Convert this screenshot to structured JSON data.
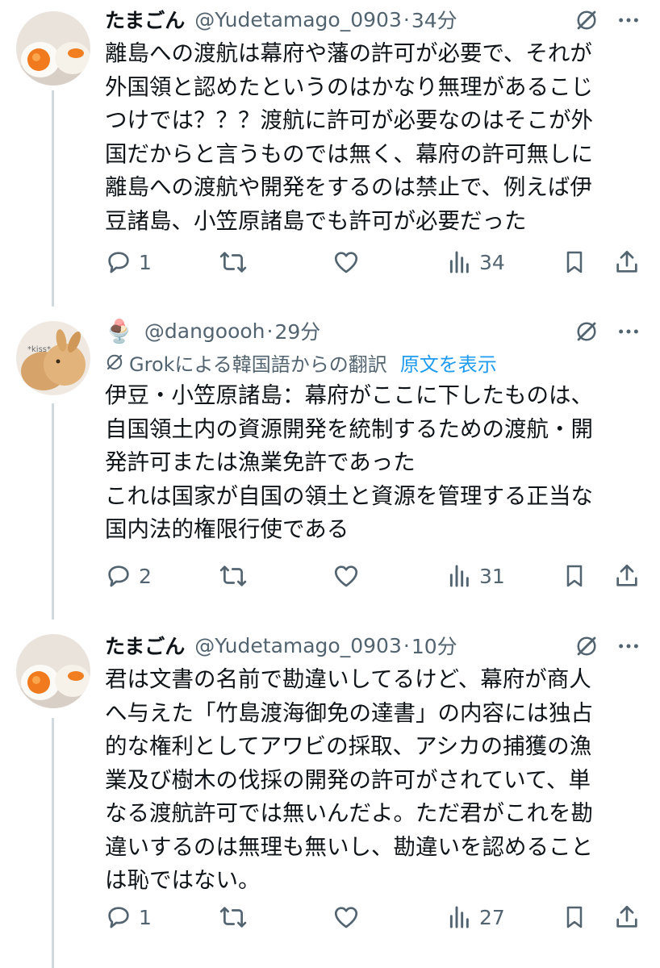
{
  "tweets": [
    {
      "name": "たまごん",
      "handle": "@Yudetamago_0903",
      "dot": "·",
      "time": "34分",
      "text": "離島への渡航は幕府や藩の許可が必要で、それが\n外国領と認めたというのはかなり無理があるこじ\nつけでは？？？渡航に許可が必要なのはそこが外\n国だからと言うものでは無く、幕府の許可無しに\n離島への渡航や開発をするのは禁止で、例えば伊\n豆諸島、小笠原諸島でも許可が必要だった",
      "replies": "1",
      "views": "34"
    },
    {
      "name": "🍨",
      "handle": "@dangoooh",
      "dot": "·",
      "time": "29分",
      "avatar_text": "*kiss*",
      "translate_label": "Grokによる韓国語からの翻訳",
      "translate_link": "原文を表示",
      "text": "伊豆・小笠原諸島：幕府がここに下したものは、\n自国領土内の資源開発を統制するための渡航・開\n発許可または漁業免許であった\nこれは国家が自国の領土と資源を管理する正当な\n国内法的権限行使である",
      "replies": "2",
      "views": "31"
    },
    {
      "name": "たまごん",
      "handle": "@Yudetamago_0903",
      "dot": "·",
      "time": "10分",
      "text": "君は文書の名前で勘違いしてるけど、幕府が商人\nへ与えた「竹島渡海御免の達書」の内容には独占\n的な権利としてアワビの採取、アシカの捕獲の漁\n業及び樹木の伐採の開発の許可がされていて、単\nなる渡航許可では無いんだよ。ただ君がこれを勘\n違いするのは無理も無いし、勘違いを認めること\nは恥ではない。",
      "replies": "1",
      "views": "27"
    }
  ],
  "icons": {
    "grok": "grok-icon",
    "more": "more-icon",
    "reply": "reply-icon",
    "repost": "repost-icon",
    "like": "like-icon",
    "views": "views-icon",
    "bookmark": "bookmark-icon",
    "share": "share-icon"
  },
  "colors": {
    "text": "#0f1419",
    "secondary": "#536471",
    "link": "#1d9bf0",
    "thread_line": "#cfd9de"
  }
}
